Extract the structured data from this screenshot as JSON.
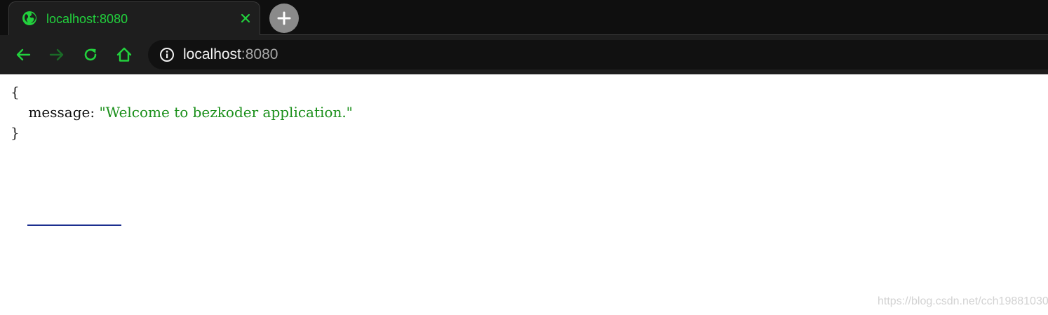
{
  "tab": {
    "title": "localhost:8080"
  },
  "toolbar": {
    "url_host": "localhost",
    "url_port": ":8080"
  },
  "page": {
    "json_open": "{",
    "json_key": "message",
    "json_separator": ": ",
    "json_value": "\"Welcome to bezkoder application.\"",
    "json_close": "}",
    "watermark": "https://blog.csdn.net/cch19881030"
  },
  "colors": {
    "accent": "#22d13d",
    "string_value": "#1a8f1a",
    "chrome_dark": "#1e1e1e"
  },
  "icons": [
    "globe-icon",
    "close-icon",
    "plus-icon",
    "back-arrow-icon",
    "forward-arrow-icon",
    "reload-icon",
    "home-icon",
    "info-icon"
  ]
}
